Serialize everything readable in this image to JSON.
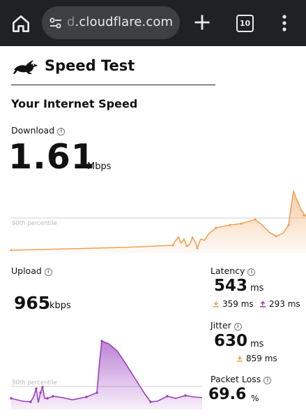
{
  "browser": {
    "url_prefix": "d",
    "url_domain": ".cloudflare.com",
    "tab_count": "10"
  },
  "page": {
    "brand_title": "Speed Test",
    "section_title": "Your Internet Speed"
  },
  "download": {
    "label": "Download",
    "value": "1.61",
    "unit": "Mbps",
    "percentile_label": "90th percentile",
    "color": "#f0a25a"
  },
  "upload": {
    "label": "Upload",
    "value": "965",
    "unit": "kbps",
    "percentile_label": "90th percentile",
    "color": "#9b3fbf"
  },
  "latency": {
    "label": "Latency",
    "value": "543",
    "unit": "ms",
    "download_value": "359 ms",
    "upload_value": "293 ms"
  },
  "jitter": {
    "label": "Jitter",
    "value": "630",
    "unit": "ms",
    "download_value": "859 ms"
  },
  "packet_loss": {
    "label": "Packet Loss",
    "value": "69.6",
    "unit": "%"
  },
  "icons": {
    "home": "home-icon",
    "tune": "tune-icon",
    "plus": "plus-icon",
    "tabs": "tab-switcher-icon",
    "menu": "more-vert-icon",
    "logo": "rabbit-logo-icon",
    "info": "info-icon",
    "download_arrow": "download-arrow-icon",
    "upload_arrow": "upload-arrow-icon"
  }
}
